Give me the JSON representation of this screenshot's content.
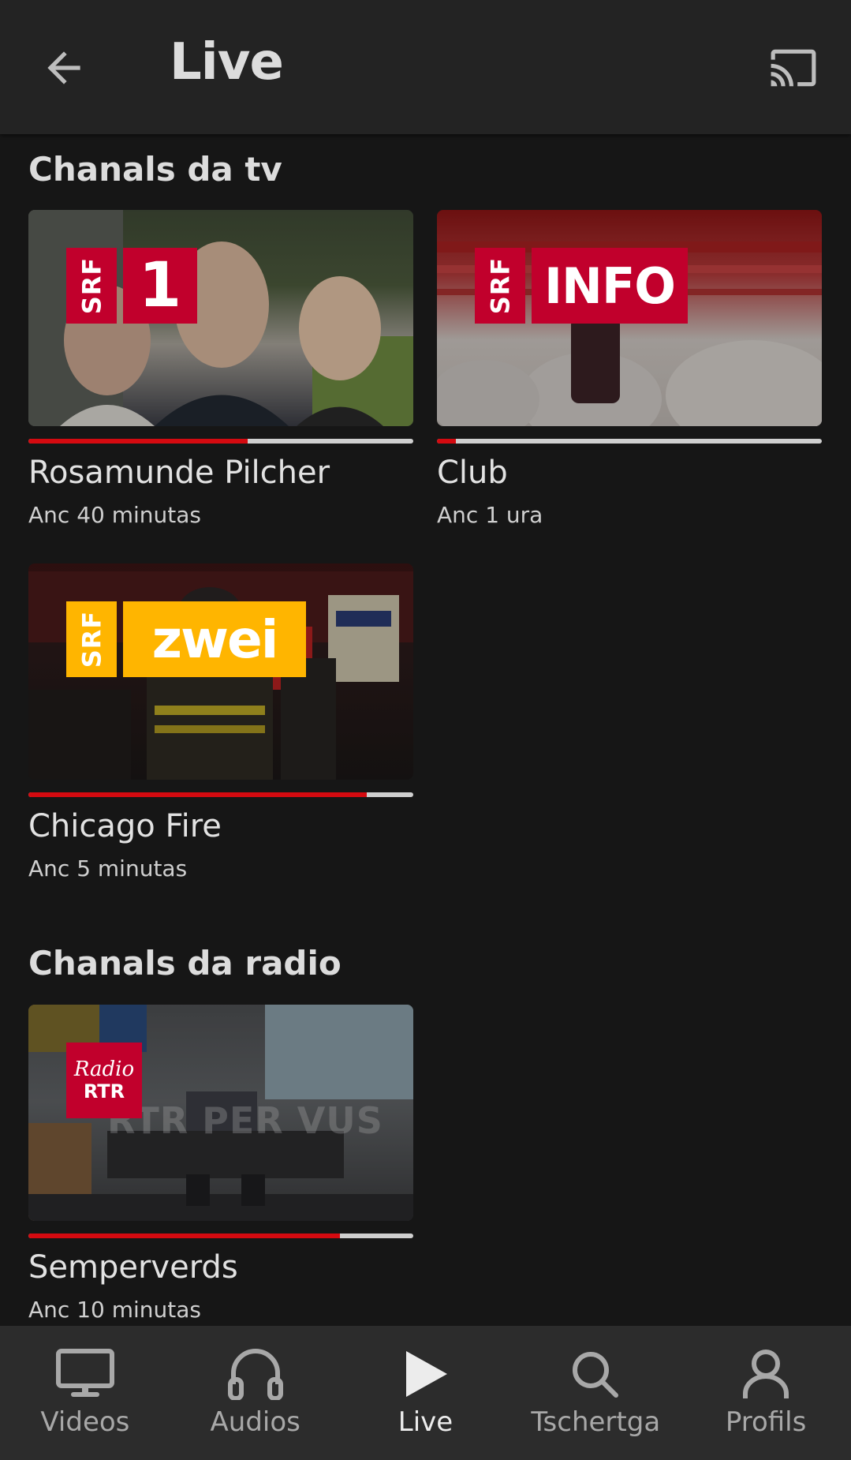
{
  "header": {
    "title": "Live",
    "back_icon": "arrow-left-icon",
    "cast_icon": "cast-icon"
  },
  "tv_section": {
    "title": "Chanals da tv",
    "channels": [
      {
        "logo_prefix": "SRF",
        "logo_name": "1",
        "logo_color": "#c1002c",
        "program": "Rosamunde Pilcher",
        "remaining": "Anc 40 minutas",
        "progress": 0.57
      },
      {
        "logo_prefix": "SRF",
        "logo_name": "INFO",
        "logo_color": "#c1002c",
        "program": "Club",
        "remaining": "Anc 1 ura",
        "progress": 0.05
      },
      {
        "logo_prefix": "SRF",
        "logo_name": "zwei",
        "logo_color": "#ffb500",
        "program": "Chicago Fire",
        "remaining": "Anc 5 minutas",
        "progress": 0.88
      }
    ]
  },
  "radio_section": {
    "title": "Chanals da radio",
    "channels": [
      {
        "logo_line1": "Radio",
        "logo_line2": "RTR",
        "logo_color": "#c1002c",
        "program": "Semperverds",
        "remaining": "Anc 10 minutas",
        "progress": 0.81
      }
    ]
  },
  "bottom_nav": [
    {
      "label": "Videos",
      "icon": "monitor-icon",
      "active": false
    },
    {
      "label": "Audios",
      "icon": "headphones-icon",
      "active": false
    },
    {
      "label": "Live",
      "icon": "play-icon",
      "active": true
    },
    {
      "label": "Tschertga",
      "icon": "search-icon",
      "active": false
    },
    {
      "label": "Profils",
      "icon": "person-icon",
      "active": false
    }
  ],
  "colors": {
    "accent": "#d40a10",
    "background": "#161616",
    "appbar": "#232323",
    "navbar": "#2c2c2c"
  }
}
